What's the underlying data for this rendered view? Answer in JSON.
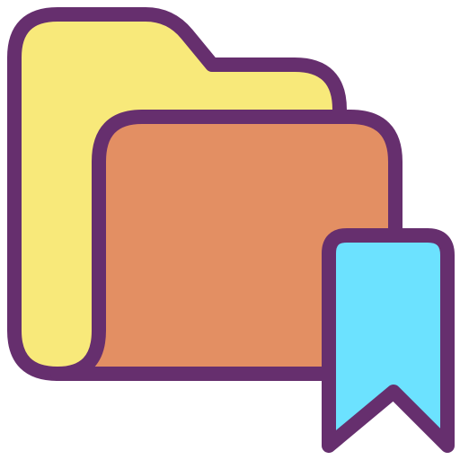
{
  "icon": {
    "name": "bookmarked-folder-icon",
    "parts": {
      "back_folder": "folder-back-icon",
      "front_folder": "folder-front-icon",
      "bookmark": "bookmark-ribbon-icon"
    },
    "colors": {
      "outline": "#662F6E",
      "back_folder_fill": "#F8E97A",
      "front_folder_fill": "#E38F63",
      "bookmark_fill": "#6CE2FF",
      "background": "#FFFFFF"
    }
  }
}
